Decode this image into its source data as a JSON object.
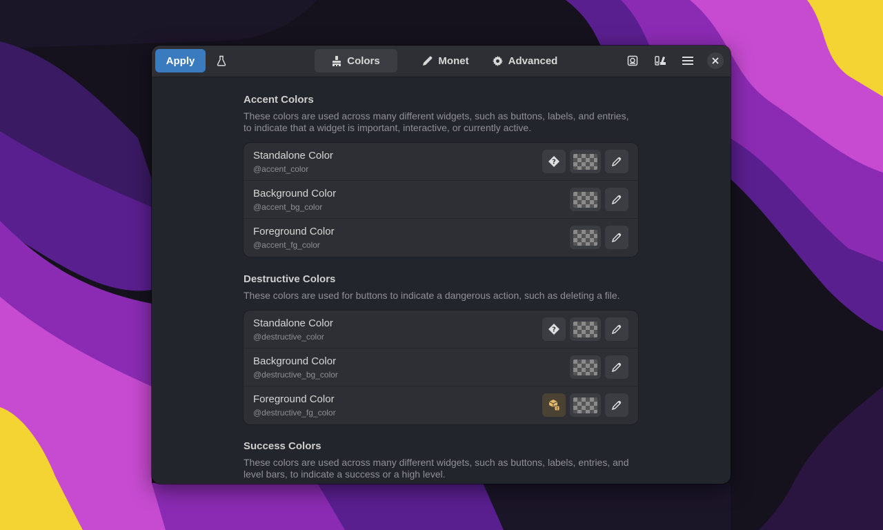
{
  "headerbar": {
    "apply_label": "Apply",
    "tabs": [
      {
        "label": "Colors",
        "icon": "brush-icon",
        "active": true
      },
      {
        "label": "Monet",
        "icon": "eyedropper-icon",
        "active": false
      },
      {
        "label": "Advanced",
        "icon": "gear-icon",
        "active": false
      }
    ]
  },
  "sections": [
    {
      "title": "Accent Colors",
      "description": "These colors are used across many different widgets, such as buttons, labels, and entries, to indicate that a widget is important, interactive, or currently active.",
      "rows": [
        {
          "title": "Standalone Color",
          "variable": "@accent_color"
        },
        {
          "title": "Background Color",
          "variable": "@accent_bg_color"
        },
        {
          "title": "Foreground Color",
          "variable": "@accent_fg_color"
        }
      ]
    },
    {
      "title": "Destructive Colors",
      "description": "These colors are used for buttons to indicate a dangerous action, such as deleting a file.",
      "rows": [
        {
          "title": "Standalone Color",
          "variable": "@destructive_color"
        },
        {
          "title": "Background Color",
          "variable": "@destructive_bg_color"
        },
        {
          "title": "Foreground Color",
          "variable": "@destructive_fg_color"
        }
      ]
    },
    {
      "title": "Success Colors",
      "description": "These colors are used across many different widgets, such as buttons, labels, entries, and level bars, to indicate a success or a high level."
    }
  ],
  "colors": {
    "accent": "#3a7bbf",
    "window_bg": "#22252b",
    "warning_icon": "#e5b96a"
  }
}
